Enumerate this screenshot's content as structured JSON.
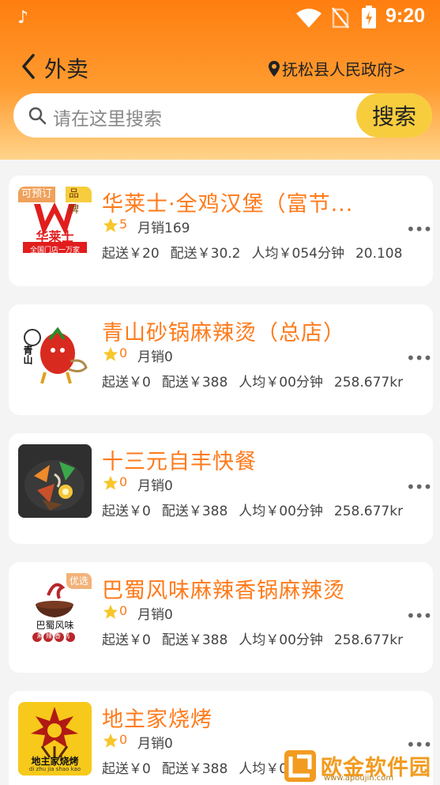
{
  "status_bar": {
    "time": "9:20",
    "app_icon": "tiktok-icon"
  },
  "header": {
    "back_icon": "chevron-left-icon",
    "title": "外卖",
    "location": "抚松县人民政府>"
  },
  "search": {
    "placeholder": "请在这里搜索",
    "button": "搜索"
  },
  "colors": {
    "accent": "#ff7a1a",
    "header_top": "#ff7e0f",
    "search_button": "#f7cd3e"
  },
  "shops": [
    {
      "name": "华莱士·全鸡汉堡（富节...",
      "rating": "5",
      "monthly_sales": "月销169",
      "min_order": "起送￥20",
      "delivery_fee": "配送￥30.2",
      "avg_time": "人均￥054分钟",
      "distance": "20.108",
      "tags": [
        "可预订",
        "品牌"
      ]
    },
    {
      "name": "青山砂锅麻辣烫（总店）",
      "rating": "0",
      "monthly_sales": "月销0",
      "min_order": "起送￥0",
      "delivery_fee": "配送￥388",
      "avg_time": "人均￥00分钟",
      "distance": "258.677kr",
      "tags": []
    },
    {
      "name": "十三元自丰快餐",
      "rating": "0",
      "monthly_sales": "月销0",
      "min_order": "起送￥0",
      "delivery_fee": "配送￥388",
      "avg_time": "人均￥00分钟",
      "distance": "258.677kr",
      "tags": []
    },
    {
      "name": "巴蜀风味麻辣香锅麻辣烫",
      "rating": "0",
      "monthly_sales": "月销0",
      "min_order": "起送￥0",
      "delivery_fee": "配送￥388",
      "avg_time": "人均￥00分钟",
      "distance": "258.677kr",
      "tags": [
        "优选"
      ]
    },
    {
      "name": "地主家烧烤",
      "rating": "0",
      "monthly_sales": "月销0",
      "min_order": "起送￥0",
      "delivery_fee": "配送￥388",
      "avg_time": "人均￥00",
      "distance": "",
      "tags": []
    }
  ],
  "thumb_labels": {
    "huala": "华莱士",
    "huala_sub": "全国门店一万家",
    "qingshan": "青山",
    "bashu": "巴蜀风味",
    "bashu_sub": "麻辣香锅",
    "dizhu": "地主家烧烤",
    "dizhu_sub": "di zhu jia shao kao"
  },
  "watermark": {
    "text": "欧金软件园",
    "url": "www.apoujin.com"
  }
}
